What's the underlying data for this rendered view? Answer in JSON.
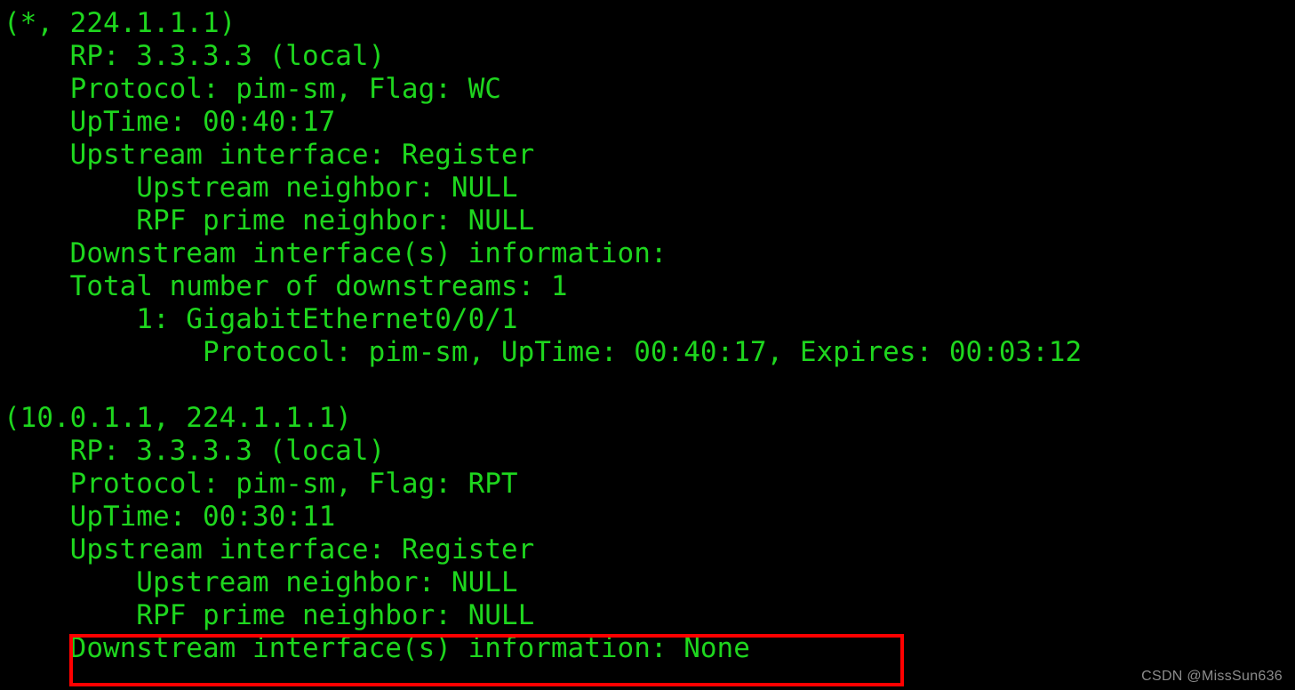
{
  "terminal": {
    "background_color": "#000000",
    "text_color": "#1ed61e",
    "highlight_color": "#ff0000",
    "watermark_color": "#8c8c8c",
    "lines": [
      "(*, 224.1.1.1)",
      "    RP: 3.3.3.3 (local)",
      "    Protocol: pim-sm, Flag: WC",
      "    UpTime: 00:40:17",
      "    Upstream interface: Register",
      "        Upstream neighbor: NULL",
      "        RPF prime neighbor: NULL",
      "    Downstream interface(s) information:",
      "    Total number of downstreams: 1",
      "        1: GigabitEthernet0/0/1",
      "            Protocol: pim-sm, UpTime: 00:40:17, Expires: 00:03:12",
      "",
      "(10.0.1.1, 224.1.1.1)",
      "    RP: 3.3.3.3 (local)",
      "    Protocol: pim-sm, Flag: RPT",
      "    UpTime: 00:30:11",
      "    Upstream interface: Register",
      "        Upstream neighbor: NULL",
      "        RPF prime neighbor: NULL",
      "    Downstream interface(s) information: None"
    ]
  },
  "highlight": {
    "label": "Downstream interface(s) information: None"
  },
  "watermark": {
    "text": "CSDN @MissSun636"
  }
}
